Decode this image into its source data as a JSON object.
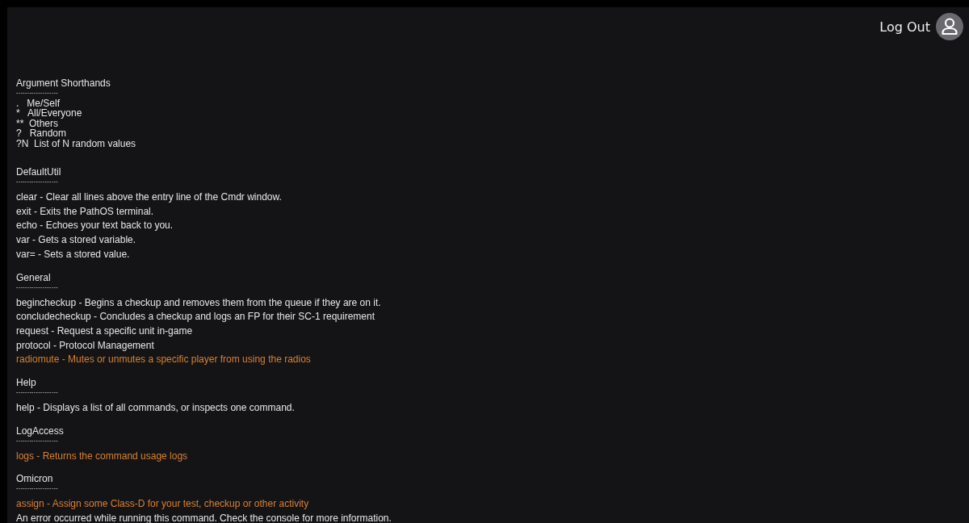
{
  "header": {
    "logout_label": "Log Out"
  },
  "shorthands": {
    "title": "Argument Shorthands",
    "rule": "-------------------",
    "items": [
      ".   Me/Self",
      "*   All/Everyone",
      "**  Others",
      "?   Random",
      "?N  List of N random values"
    ]
  },
  "sections": [
    {
      "title": "DefaultUtil",
      "rule": "-------------------",
      "commands": [
        {
          "text": "clear - Clear all lines above the entry line of the Cmdr window.",
          "highlighted": false
        },
        {
          "text": "exit - Exits the PathOS terminal.",
          "highlighted": false
        },
        {
          "text": "echo - Echoes your text back to you.",
          "highlighted": false
        },
        {
          "text": "var - Gets a stored variable.",
          "highlighted": false
        },
        {
          "text": "var= - Sets a stored value.",
          "highlighted": false
        }
      ]
    },
    {
      "title": "General",
      "rule": "-------------------",
      "commands": [
        {
          "text": "begincheckup - Begins a checkup and removes them from the queue if they are on it.",
          "highlighted": false
        },
        {
          "text": "concludecheckup - Concludes a checkup and logs an FP for their SC-1 requirement",
          "highlighted": false
        },
        {
          "text": "request - Request a specific unit in-game",
          "highlighted": false
        },
        {
          "text": "protocol - Protocol Management",
          "highlighted": false
        },
        {
          "text": "radiomute - Mutes or unmutes a specific player from using the radios",
          "highlighted": true
        }
      ]
    },
    {
      "title": "Help",
      "rule": "-------------------",
      "commands": [
        {
          "text": "help - Displays a list of all commands, or inspects one command.",
          "highlighted": false
        }
      ]
    },
    {
      "title": "LogAccess",
      "rule": "-------------------",
      "commands": [
        {
          "text": "logs - Returns the command usage logs",
          "highlighted": true
        }
      ]
    },
    {
      "title": "Omicron",
      "rule": "-------------------",
      "commands": [
        {
          "text": "assign - Assign some Class-D for your test, checkup or other activity",
          "highlighted": true
        }
      ]
    }
  ],
  "error_line": "An error occurred while running this command. Check the console for more information."
}
